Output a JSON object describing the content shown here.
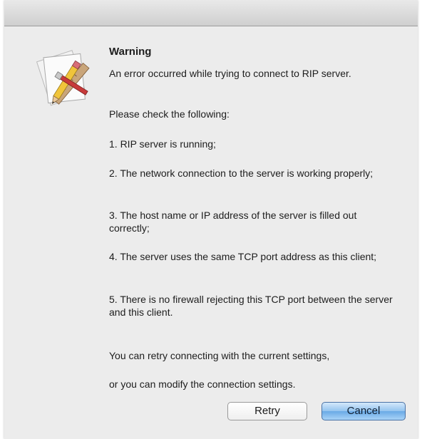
{
  "dialog": {
    "icon": "app-document-pencil-icon",
    "title": "Warning",
    "intro": "An error occurred while trying to connect to RIP server.",
    "check_heading": "Please check the following:",
    "items": [
      "1. RIP server is running;",
      "2. The network connection to the server is working properly;",
      "3. The host name or IP address of the server is filled out correctly;",
      "4. The server uses the same TCP port address as this client;",
      "5. There is no firewall rejecting this TCP port between the server and this client."
    ],
    "retry_note": "You can retry connecting with the current settings,",
    "modify_note": "or you can modify the connection settings."
  },
  "buttons": {
    "retry_label": "Retry",
    "cancel_label": "Cancel",
    "default_button_color": "#7bb4ec"
  }
}
